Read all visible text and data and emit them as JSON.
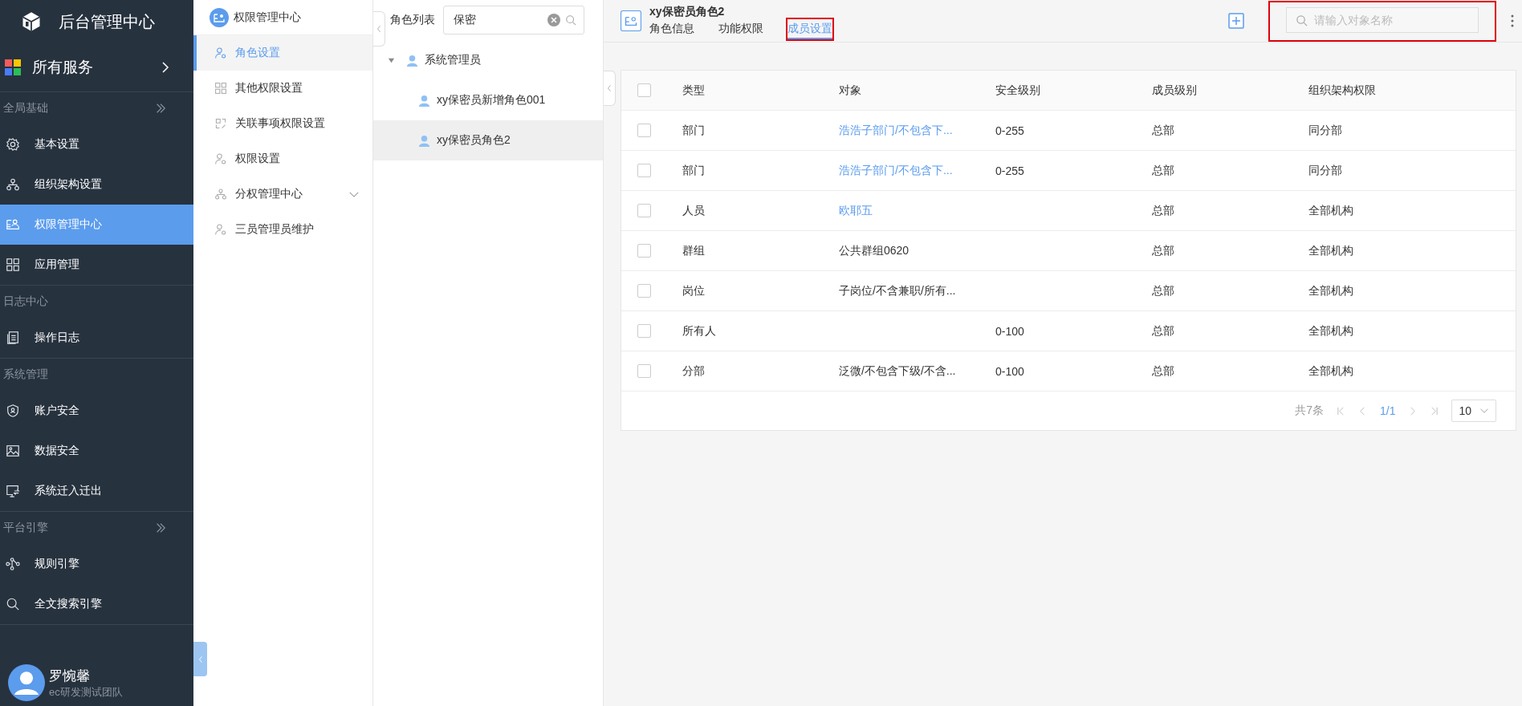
{
  "sidebar": {
    "title": "后台管理中心",
    "services": {
      "label": "所有服务"
    },
    "sections": [
      {
        "label": "全局基础",
        "has_toggle": true,
        "items": [
          {
            "label": "基本设置",
            "selected": false
          },
          {
            "label": "组织架构设置",
            "selected": false
          },
          {
            "label": "权限管理中心",
            "selected": true
          },
          {
            "label": "应用管理",
            "selected": false
          }
        ]
      },
      {
        "label": "日志中心",
        "has_toggle": false,
        "items": [
          {
            "label": "操作日志",
            "selected": false
          }
        ]
      },
      {
        "label": "系统管理",
        "has_toggle": false,
        "items": [
          {
            "label": "账户安全",
            "selected": false
          },
          {
            "label": "数据安全",
            "selected": false
          },
          {
            "label": "系统迁入迁出",
            "selected": false
          }
        ]
      },
      {
        "label": "平台引擎",
        "has_toggle": true,
        "items": [
          {
            "label": "规则引擎",
            "selected": false
          },
          {
            "label": "全文搜索引擎",
            "selected": false
          }
        ]
      }
    ],
    "user": {
      "name": "罗惋馨",
      "team": "ec研发测试团队"
    }
  },
  "submenu": {
    "title": "权限管理中心",
    "items": [
      {
        "label": "角色设置",
        "selected": true
      },
      {
        "label": "其他权限设置",
        "selected": false
      },
      {
        "label": "关联事项权限设置",
        "selected": false
      },
      {
        "label": "权限设置",
        "selected": false
      },
      {
        "label": "分权管理中心",
        "selected": false,
        "expanded": false
      },
      {
        "label": "三员管理员维护",
        "selected": false
      }
    ]
  },
  "roles": {
    "label": "角色列表",
    "search": {
      "value": "保密"
    },
    "tree": [
      {
        "label": "系统管理员",
        "expanded": true,
        "selected": false,
        "children": [
          {
            "label": "xy保密员新增角色001",
            "selected": false
          },
          {
            "label": "xy保密员角色2",
            "selected": true
          }
        ]
      }
    ]
  },
  "main": {
    "title": "xy保密员角色2",
    "tabs": [
      {
        "label": "角色信息",
        "selected": false,
        "highlighted": false
      },
      {
        "label": "功能权限",
        "selected": false,
        "highlighted": false
      },
      {
        "label": "成员设置",
        "selected": true,
        "highlighted": true
      }
    ],
    "search": {
      "placeholder": "请输入对象名称",
      "highlighted": true
    },
    "table": {
      "all_checked": false,
      "columns": [
        "类型",
        "对象",
        "安全级别",
        "成员级别",
        "组织架构权限"
      ],
      "rows": [
        {
          "checked": false,
          "type": "部门",
          "object": {
            "text": "浩浩子部门/不包含下...",
            "link": true
          },
          "security": "0-255",
          "member_level": "总部",
          "org_scope": "同分部"
        },
        {
          "checked": false,
          "type": "部门",
          "object": {
            "text": "浩浩子部门/不包含下...",
            "link": true
          },
          "security": "0-255",
          "member_level": "总部",
          "org_scope": "同分部"
        },
        {
          "checked": false,
          "type": "人员",
          "object": {
            "text": "欧耶五",
            "link": true
          },
          "member_level": "总部",
          "org_scope": "全部机构"
        },
        {
          "checked": false,
          "type": "群组",
          "object": {
            "text": "公共群组0620",
            "link": false
          },
          "member_level": "总部",
          "org_scope": "全部机构"
        },
        {
          "checked": false,
          "type": "岗位",
          "object": {
            "text": "子岗位/不含兼职/所有...",
            "link": false
          },
          "member_level": "总部",
          "org_scope": "全部机构"
        },
        {
          "checked": false,
          "type": "所有人",
          "security": "0-100",
          "member_level": "总部",
          "org_scope": "全部机构"
        },
        {
          "checked": false,
          "type": "分部",
          "object": {
            "text": "泛微/不包含下级/不含...",
            "link": false
          },
          "security": "0-100",
          "member_level": "总部",
          "org_scope": "全部机构"
        }
      ]
    },
    "pagination": {
      "total": "共7条",
      "page": "1/1",
      "page_size": "10"
    }
  }
}
